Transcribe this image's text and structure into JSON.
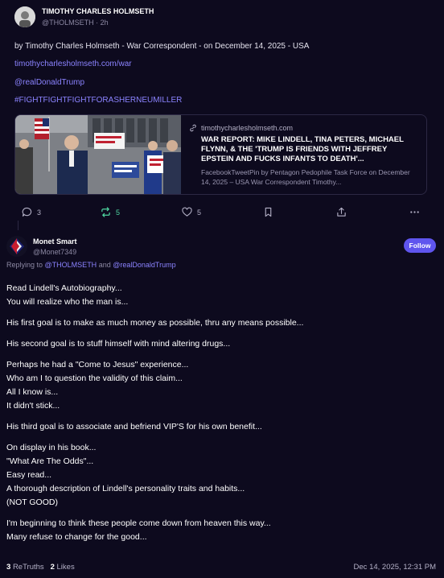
{
  "post": {
    "author": "TIMOTHY CHARLES HOLMSETH",
    "handle": "@THOLMSETH",
    "time": "2h",
    "headline": "by Timothy Charles Holmseth - War Correspondent - on December 14, 2025 - USA",
    "link1": "timothycharlesholmseth.com/war",
    "mention": "@realDonaldTrump",
    "hashtag": "#FIGHTFIGHTFIGHTFORASHERNEUMILLER",
    "card": {
      "domain": "timothycharlesholmseth.com",
      "title": "WAR REPORT: MIKE LINDELL, TINA PETERS, MICHAEL FLYNN, & THE 'TRUMP IS FRIENDS WITH JEFFREY EPSTEIN AND FUCKS INFANTS TO DEATH'...",
      "desc": "FacebookTweetPin by Pentagon Pedophile Task Force on December 14, 2025 – USA War Correspondent Timothy..."
    },
    "actions": {
      "replies": "3",
      "retruths": "5",
      "likes": "5"
    }
  },
  "reply": {
    "author": "Monet Smart",
    "handle": "@Monet7349",
    "follow": "Follow",
    "replying_prefix": "Replying to",
    "replying_to": "@THOLMSETH",
    "replying_and": "and",
    "replying_to2": "@realDonaldTrump",
    "paragraphs": [
      [
        "Read Lindell's Autobiography...",
        "You will realize who the man is..."
      ],
      [
        "His first goal is to make as much money as possible, thru any means possible..."
      ],
      [
        "His second goal is to stuff himself with mind altering drugs..."
      ],
      [
        "Perhaps he had a \"Come to Jesus\" experience...",
        "Who am I to question the validity of this claim...",
        "All I know is...",
        "It didn't stick..."
      ],
      [
        "His third goal is to associate and befriend VIP'S for his own benefit..."
      ],
      [
        "On display in his book...",
        "\"What Are The Odds\"...",
        "Easy read...",
        "A thorough description of Lindell's personality traits and habits...",
        "(NOT GOOD)"
      ],
      [
        "I'm beginning to think these people come down from heaven this way...",
        "Many refuse to change for the good..."
      ]
    ],
    "retruths_count": "3",
    "retruths_label": "ReTruths",
    "likes_count": "2",
    "likes_label": "Likes",
    "timestamp": "Dec 14, 2025, 12:31 PM"
  },
  "colors": {
    "background": "#0d0a1e",
    "accent": "#8b83ff",
    "retruth_green": "#4ed6a0",
    "follow_button": "#5f55ee"
  },
  "icons": [
    "reply-icon",
    "retruth-icon",
    "heart-icon",
    "bookmark-icon",
    "share-icon",
    "more-icon",
    "link-icon"
  ]
}
